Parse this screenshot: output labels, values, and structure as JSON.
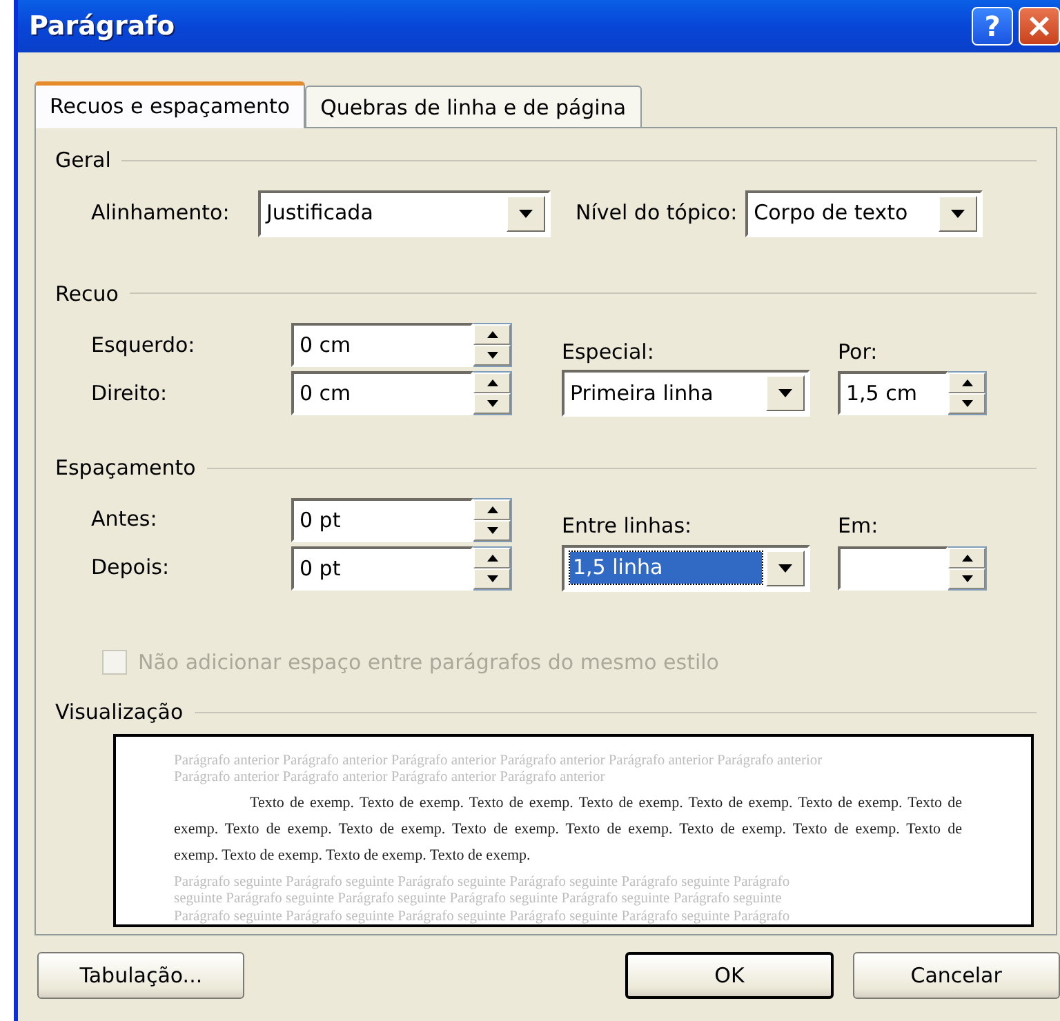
{
  "window": {
    "title": "Parágrafo",
    "help_label": "?"
  },
  "tabs": [
    {
      "label": "Recuos e espaçamento",
      "selected": true
    },
    {
      "label": "Quebras de linha e de página",
      "selected": false
    }
  ],
  "geral": {
    "title": "Geral",
    "alignment": {
      "label": "Alinhamento:",
      "value": "Justificada"
    },
    "outline_level": {
      "label": "Nível do tópico:",
      "value": "Corpo de texto"
    }
  },
  "recuo": {
    "title": "Recuo",
    "left": {
      "label": "Esquerdo:",
      "value": "0 cm"
    },
    "right": {
      "label": "Direito:",
      "value": "0 cm"
    },
    "special": {
      "label": "Especial:",
      "value": "Primeira linha",
      "selected": false
    },
    "by": {
      "label": "Por:",
      "value": "1,5 cm"
    }
  },
  "espacamento": {
    "title": "Espaçamento",
    "before": {
      "label": "Antes:",
      "value": "0 pt"
    },
    "after": {
      "label": "Depois:",
      "value": "0 pt"
    },
    "line_spacing": {
      "label": "Entre linhas:",
      "value": "1,5 linha",
      "selected": true
    },
    "at": {
      "label": "Em:"
    }
  },
  "checkbox": {
    "label": "Não adicionar espaço entre parágrafos do mesmo estilo",
    "checked": false,
    "disabled": true
  },
  "preview": {
    "title": "Visualização",
    "previous_lines": [
      "Parágrafo anterior Parágrafo anterior Parágrafo anterior Parágrafo anterior Parágrafo anterior Parágrafo anterior",
      "Parágrafo anterior Parágrafo anterior Parágrafo anterior Parágrafo anterior"
    ],
    "sample_lines": [
      "Texto de exemp. Texto de exemp. Texto de exemp. Texto de exemp. Texto de exemp. Texto de exemp. Texto de",
      "exemp. Texto de exemp. Texto de exemp. Texto de exemp. Texto de exemp. Texto de exemp. Texto de exemp. Texto de",
      "exemp. Texto de exemp. Texto de exemp. Texto de exemp."
    ],
    "next_lines": [
      "Parágrafo seguinte Parágrafo seguinte Parágrafo seguinte Parágrafo seguinte Parágrafo seguinte Parágrafo",
      "seguinte Parágrafo seguinte Parágrafo seguinte Parágrafo seguinte Parágrafo seguinte Parágrafo seguinte",
      "Parágrafo seguinte Parágrafo seguinte Parágrafo seguinte Parágrafo seguinte Parágrafo seguinte Parágrafo"
    ]
  },
  "buttons": [
    {
      "label": "Tabulação...",
      "default": false
    },
    {
      "label": "OK",
      "default": true
    },
    {
      "label": "Cancelar",
      "default": false
    }
  ]
}
